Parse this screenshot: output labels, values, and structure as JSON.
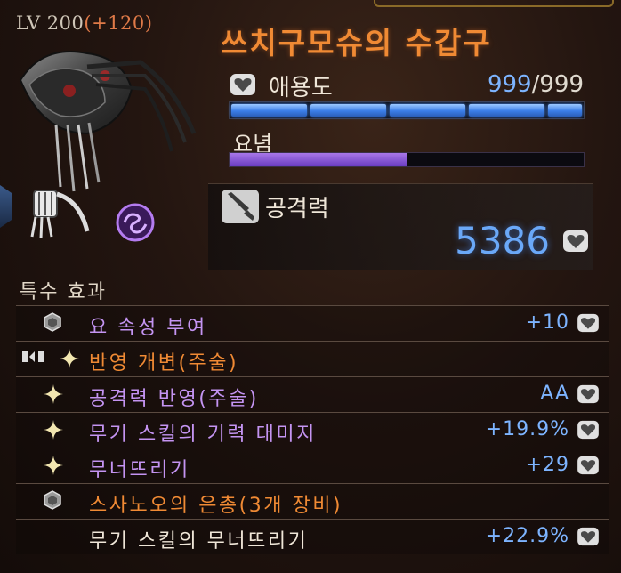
{
  "item": {
    "level_text": "LV 200",
    "level_bonus": "(+120)",
    "name": "쓰치구모슈의 수갑구"
  },
  "affinity": {
    "label": "애용도",
    "current": "999",
    "max": "/999",
    "fill": 1.0
  },
  "yonen": {
    "label": "요념",
    "fill": 0.5
  },
  "attack": {
    "label": "공격력",
    "value": "5386"
  },
  "special_effects": {
    "title": "특수 효과",
    "rows": [
      {
        "label": "요 속성 부여",
        "value": "+10",
        "color": "#c494f2",
        "icon": "hex-gem-icon",
        "badge": true
      },
      {
        "label": "반영 개변(주술)",
        "value": "",
        "color": "#f08a34",
        "icon": "sparkle-icon",
        "badge": false
      },
      {
        "label": "공격력 반영(주술)",
        "value": "AA",
        "color": "#c494f2",
        "icon": "sparkle-icon",
        "badge": true
      },
      {
        "label": "무기 스킬의 기력 대미지",
        "value": "+19.9%",
        "color": "#c494f2",
        "icon": "sparkle-icon",
        "badge": true
      },
      {
        "label": "무너뜨리기",
        "value": "+29",
        "color": "#c494f2",
        "icon": "sparkle-icon",
        "badge": true
      },
      {
        "label": "스사노오의 은총(3개 장비)",
        "value": "",
        "color": "#f08a34",
        "icon": "hex-gem-icon",
        "badge": false
      },
      {
        "label": "무기 스킬의 무너뜨리기",
        "value": "+22.9%",
        "color": "#efe6d8",
        "icon": "",
        "badge": true
      }
    ]
  },
  "colors": {
    "name_orange": "#f08a34",
    "value_blue": "#7db4ff",
    "effect_purple": "#c494f2",
    "bar_blue": "#3b7ee8",
    "bar_purple": "#6a3cc0"
  }
}
